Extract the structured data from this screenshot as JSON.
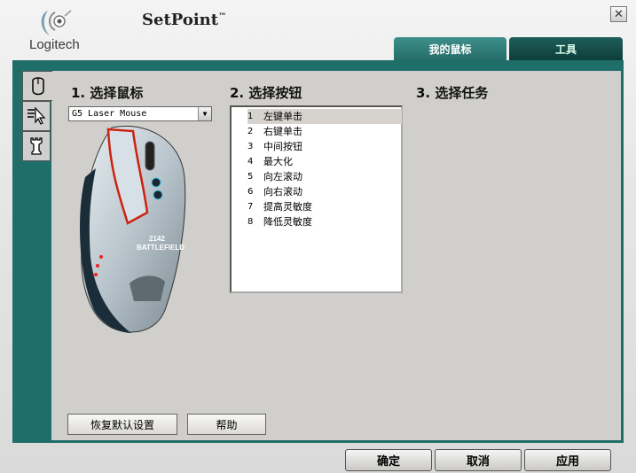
{
  "header": {
    "logo_text": "Logitech",
    "app_title": "SetPoint",
    "trademark": "™"
  },
  "tabs": [
    {
      "label": "我的鼠标",
      "active": true
    },
    {
      "label": "工具",
      "active": false
    }
  ],
  "close_icon": "close-icon",
  "sidebar": {
    "items": [
      {
        "name": "mouse-icon",
        "active": true
      },
      {
        "name": "pointer-speed-icon",
        "active": false
      },
      {
        "name": "chess-rook-icon",
        "active": false
      }
    ]
  },
  "section1": {
    "heading": "1. 选择鼠标",
    "selected_mouse": "G5 Laser Mouse"
  },
  "section2": {
    "heading": "2. 选择按钮",
    "buttons": [
      {
        "num": "1",
        "label": "左键单击"
      },
      {
        "num": "2",
        "label": "右键单击"
      },
      {
        "num": "3",
        "label": "中间按钮"
      },
      {
        "num": "4",
        "label": "最大化"
      },
      {
        "num": "5",
        "label": "向左滚动"
      },
      {
        "num": "6",
        "label": "向右滚动"
      },
      {
        "num": "7",
        "label": "提高灵敏度"
      },
      {
        "num": "8",
        "label": "降低灵敏度"
      }
    ],
    "selected_index": 0
  },
  "section3": {
    "heading": "3. 选择任务"
  },
  "panel_buttons": {
    "restore_defaults": "恢复默认设置",
    "help": "帮助"
  },
  "footer_buttons": {
    "ok": "确定",
    "cancel": "取消",
    "apply": "应用"
  },
  "colors": {
    "frame": "#1f6e69",
    "tab_active": "#2f7e7a",
    "tab_inactive": "#134a47",
    "panel": "#d0cfcc"
  },
  "mouse_image": {
    "graphic_text_top": "2142",
    "graphic_text_bottom": "BATTLEFIELD"
  }
}
